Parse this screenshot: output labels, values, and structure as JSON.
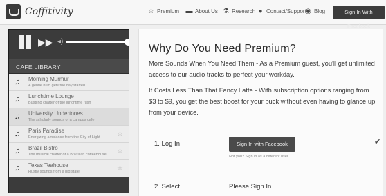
{
  "app": {
    "logo_text": "Coffitivity"
  },
  "nav": {
    "premium": "Premium",
    "about": "About Us",
    "research": "Research",
    "contact": "Contact/Support",
    "blog": "Blog",
    "signin": "Sign In With Facebook"
  },
  "player": {
    "volume": 1.0
  },
  "library": {
    "header": "CAFE LIBRARY",
    "tracks": [
      {
        "name": "Morning Murmur",
        "desc": "A gentle hum gets the day started"
      },
      {
        "name": "Lunchtime Lounge",
        "desc": "Bustling chatter of the lunchtime rush"
      },
      {
        "name": "University Undertones",
        "desc": "The scholarly sounds of a campus cafe"
      },
      {
        "name": "Paris Paradise",
        "desc": "Energizing ambiance from the City of Light"
      },
      {
        "name": "Brazil Bistro",
        "desc": "The musical chatter of a Brazilian coffeehouse"
      },
      {
        "name": "Texas Teahouse",
        "desc": "Hustly sounds from a big state"
      }
    ]
  },
  "main": {
    "title": "Why Do You Need Premium?",
    "p1": "More Sounds When You Need Them - As a Premium guest, you'll get unlimited access to our audio tracks to perfect your workday.",
    "p2": "It Costs Less Than That Fancy Latte - With subscription options ranging from $3 to $9, you get the best boost for your buck without even having to glance up from your device.",
    "step1_label": "1. Log In",
    "fb_button": "Sign In with Facebook",
    "fb_note": "Not you? Sign in as a different user",
    "step2_label": "2. Select",
    "please_sign_in": "Please Sign In"
  }
}
